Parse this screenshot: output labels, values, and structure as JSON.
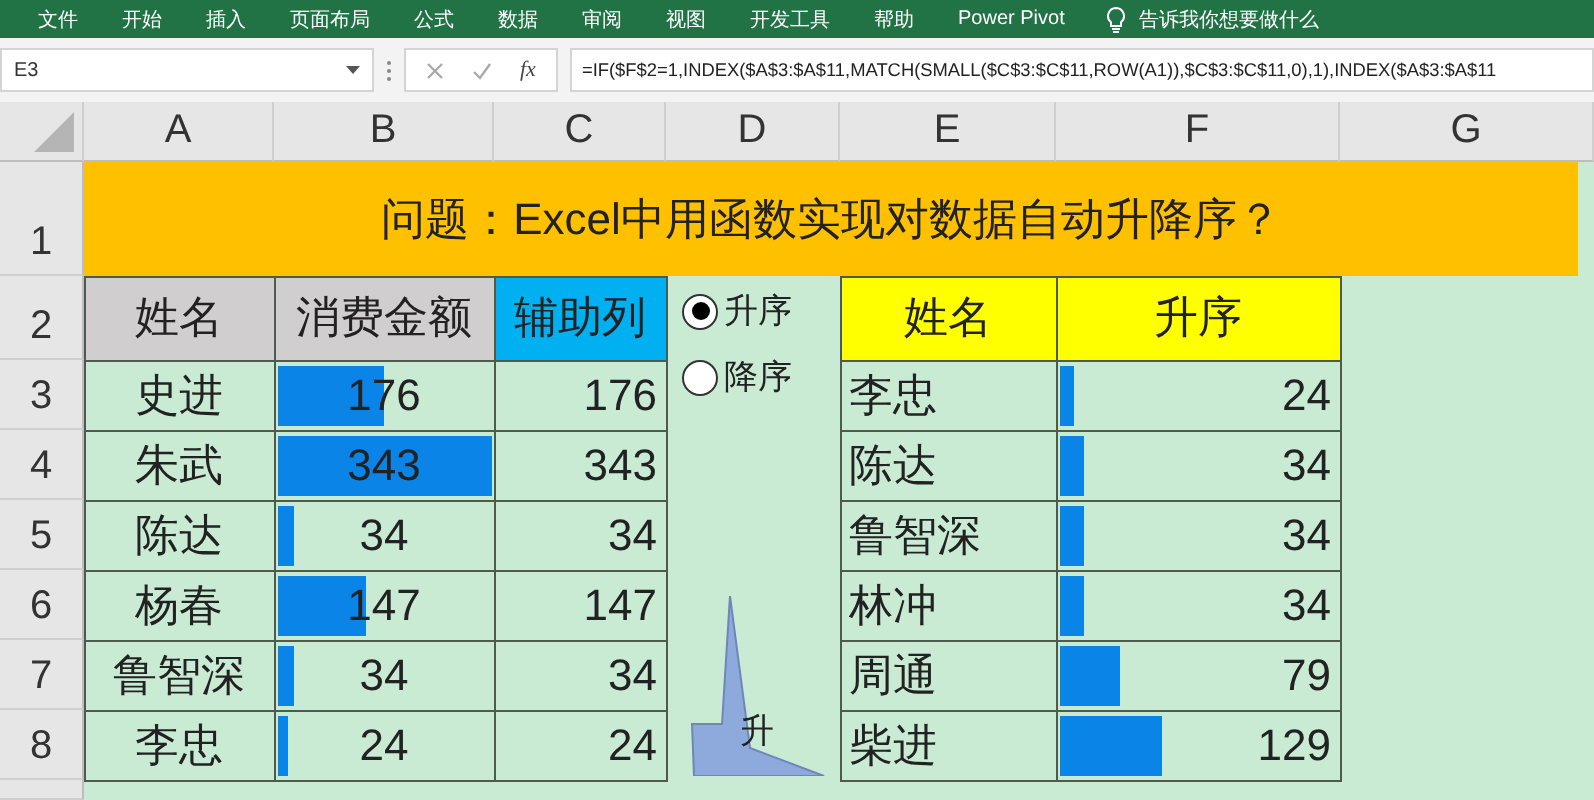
{
  "menu": [
    {
      "label": "文件"
    },
    {
      "label": "开始"
    },
    {
      "label": "插入"
    },
    {
      "label": "页面布局"
    },
    {
      "label": "公式"
    },
    {
      "label": "数据"
    },
    {
      "label": "审阅"
    },
    {
      "label": "视图"
    },
    {
      "label": "开发工具"
    },
    {
      "label": "帮助"
    },
    {
      "label": "Power Pivot"
    }
  ],
  "tell_me": "告诉我你想要做什么",
  "formula_bar": {
    "name_box": "E3",
    "function_label": "fx",
    "formula": "=IF($F$2=1,INDEX($A$3:$A$11,MATCH(SMALL($C$3:$C$11,ROW(A1)),$C$3:$C$11,0),1),INDEX($A$3:$A$11"
  },
  "columns": [
    "A",
    "B",
    "C",
    "D",
    "E",
    "F",
    "G"
  ],
  "row_numbers": [
    "1",
    "2",
    "3",
    "4",
    "5",
    "6",
    "7",
    "8"
  ],
  "title": "问题：Excel中用函数实现对数据自动升降序？",
  "left_table": {
    "headers": [
      {
        "label": "姓名",
        "color": "#d0cece"
      },
      {
        "label": "消费金额",
        "color": "#d0cece"
      },
      {
        "label": "辅助列",
        "color": "#00b0f0"
      }
    ],
    "rows": [
      {
        "name": "史进",
        "amount": "176",
        "level": 0.51,
        "helper": "176"
      },
      {
        "name": "朱武",
        "amount": "343",
        "level": 1,
        "helper": "343"
      },
      {
        "name": "陈达",
        "amount": "34",
        "level": 0.1,
        "helper": "34"
      },
      {
        "name": "杨春",
        "amount": "147",
        "level": 0.43,
        "helper": "147"
      },
      {
        "name": "鲁智深",
        "amount": "34",
        "level": 0.1,
        "helper": "34"
      },
      {
        "name": "李忠",
        "amount": "24",
        "level": 0.07,
        "helper": "24"
      }
    ]
  },
  "radios": [
    {
      "label": "升序",
      "selected": true
    },
    {
      "label": "降序",
      "selected": false
    }
  ],
  "callout": {
    "text": "升"
  },
  "right_table": {
    "headers": [
      "姓名",
      "升序"
    ],
    "rows": [
      {
        "name": "李忠",
        "value": "24",
        "level": 0.07
      },
      {
        "name": "陈达",
        "value": "34",
        "level": 0.1
      },
      {
        "name": "鲁智深",
        "value": "34",
        "level": 0.1
      },
      {
        "name": "林冲",
        "value": "34",
        "level": 0.1
      },
      {
        "name": "周通",
        "value": "79",
        "level": 0.23
      },
      {
        "name": "柴进",
        "value": "129",
        "level": 0.38
      }
    ]
  }
}
